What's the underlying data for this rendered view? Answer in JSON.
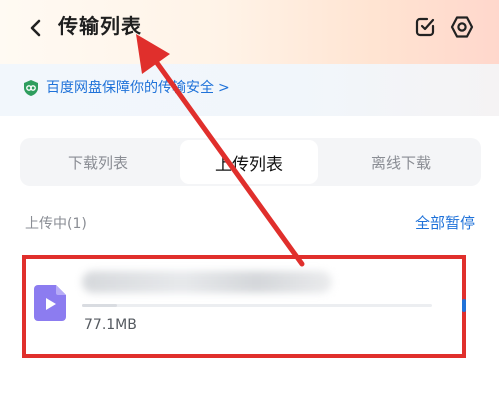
{
  "header": {
    "title": "传输列表",
    "back_icon": "chevron-left-icon",
    "actions": [
      "checkbox-icon",
      "settings-hexagon-icon"
    ]
  },
  "security_banner": {
    "text": "百度网盘保障你的传输安全",
    "arrow": ">",
    "icon": "shield-icon"
  },
  "tabs": [
    {
      "label": "下载列表",
      "active": false
    },
    {
      "label": "上传列表",
      "active": true
    },
    {
      "label": "离线下载",
      "active": false
    }
  ],
  "section": {
    "title": "上传中(1)",
    "action_label": "全部暂停"
  },
  "uploads": [
    {
      "name": "",
      "size": "77.1MB",
      "progress": 0.1,
      "icon": "video-file-icon"
    }
  ],
  "colors": {
    "accent": "#1f72d9",
    "annotation": "#e02f2c",
    "header_gradient_end": "#ffd7cc"
  }
}
